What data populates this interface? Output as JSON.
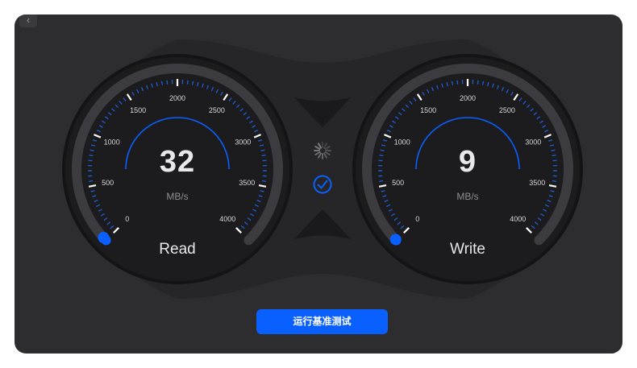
{
  "window": {
    "back_icon": "chevron-left-icon"
  },
  "read_gauge": {
    "value": "32",
    "unit": "MB/s",
    "label": "Read",
    "ticks": [
      "0",
      "500",
      "1000",
      "1500",
      "2000",
      "2500",
      "3000",
      "3500",
      "4000"
    ],
    "max": 4000,
    "current": 32
  },
  "write_gauge": {
    "value": "9",
    "unit": "MB/s",
    "label": "Write",
    "ticks": [
      "0",
      "500",
      "1000",
      "1500",
      "2000",
      "2500",
      "3000",
      "3500",
      "4000"
    ],
    "max": 4000,
    "current": 9
  },
  "center": {
    "spinner_icon": "spinner-icon",
    "check_icon": "checkmark-circle-icon"
  },
  "run_button": {
    "label": "运行基准测试"
  },
  "colors": {
    "accent": "#0a60ff",
    "background": "#2d2d2f",
    "gauge_face": "#1c1c1e"
  }
}
